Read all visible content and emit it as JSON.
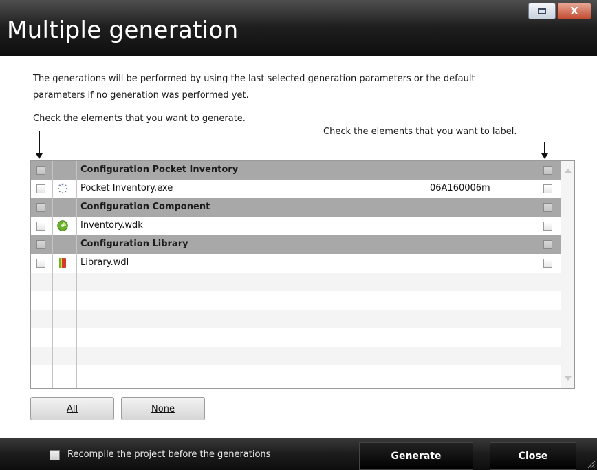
{
  "window": {
    "title": "Multiple generation",
    "controls": {
      "maximize_icon": "maximize-icon",
      "close_icon": "close-icon",
      "close_glyph": "X"
    }
  },
  "instructions": {
    "line1": "The generations will be performed by using the last selected generation parameters or the default",
    "line2": "parameters if no generation was performed yet.",
    "generate_hint": "Check the elements that you want to generate.",
    "label_hint": "Check the elements that you want to label."
  },
  "grid": {
    "rows": [
      {
        "type": "group",
        "title": "Configuration Pocket Inventory",
        "value": "",
        "checked_generate": false,
        "checked_label": false
      },
      {
        "type": "item",
        "name": "Pocket Inventory.exe",
        "icon": "executable-spinner-icon",
        "value": "06A160006m",
        "checked_generate": false,
        "checked_label": false
      },
      {
        "type": "group",
        "title": "Configuration Component",
        "value": "",
        "checked_generate": false,
        "checked_label": false
      },
      {
        "type": "item",
        "name": "Inventory.wdk",
        "icon": "component-icon",
        "value": "",
        "checked_generate": false,
        "checked_label": false
      },
      {
        "type": "group",
        "title": "Configuration Library",
        "value": "",
        "checked_generate": false,
        "checked_label": false
      },
      {
        "type": "item",
        "name": "Library.wdl",
        "icon": "library-book-icon",
        "value": "",
        "checked_generate": false,
        "checked_label": false
      }
    ]
  },
  "buttons": {
    "all": "All",
    "none": "None"
  },
  "footer": {
    "recompile_label": "Recompile the project before the generations",
    "recompile_checked": false,
    "generate": "Generate",
    "close": "Close"
  },
  "colors": {
    "titlebar": "#1f1f1f",
    "group_row": "#a8a8a8",
    "footer": "#1c1c1c",
    "close_button": "#c24d33"
  }
}
